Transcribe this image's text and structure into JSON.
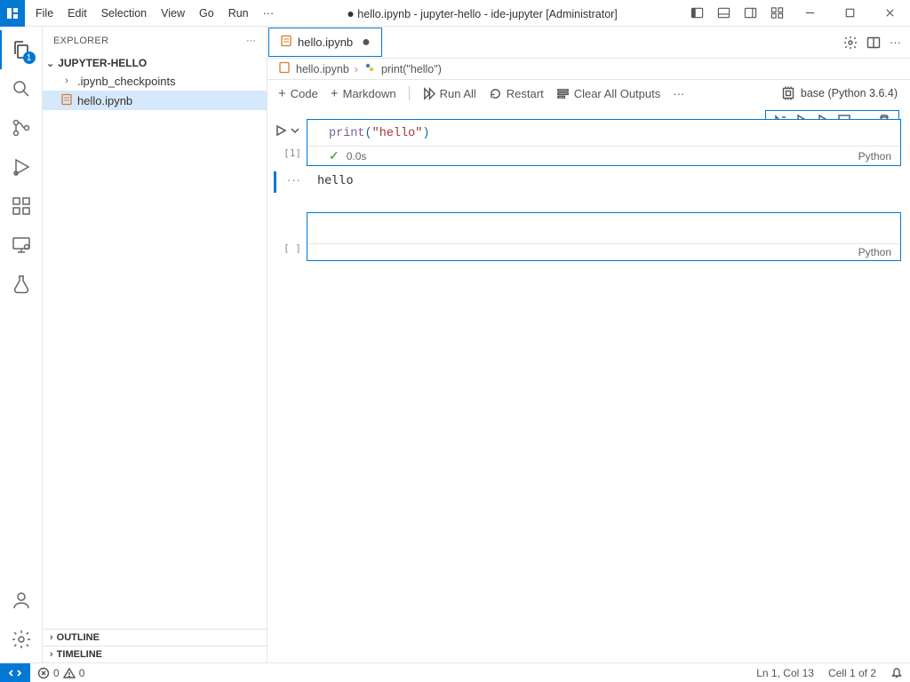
{
  "window": {
    "title": "hello.ipynb - jupyter-hello - ide-jupyter [Administrator]",
    "dirty_prefix": "●"
  },
  "menu": {
    "items": [
      "File",
      "Edit",
      "Selection",
      "View",
      "Go",
      "Run"
    ],
    "overflow": "···"
  },
  "activitybar": {
    "explorer_badge": "1"
  },
  "sidebar": {
    "title": "EXPLORER",
    "root": "JUPYTER-HELLO",
    "items": [
      {
        "label": ".ipynb_checkpoints",
        "kind": "folder"
      },
      {
        "label": "hello.ipynb",
        "kind": "notebook",
        "selected": true
      }
    ],
    "outline": "OUTLINE",
    "timeline": "TIMELINE"
  },
  "tab": {
    "label": "hello.ipynb",
    "dirty": "●"
  },
  "breadcrumbs": {
    "file": "hello.ipynb",
    "symbol": "print(\"hello\")"
  },
  "nb_toolbar": {
    "code": "Code",
    "markdown": "Markdown",
    "run_all": "Run All",
    "restart": "Restart",
    "clear": "Clear All Outputs",
    "kernel": "base (Python 3.6.4)"
  },
  "cells": [
    {
      "exec_count": "[1]",
      "code": {
        "fn": "print",
        "str": "\"hello\""
      },
      "status_time": "0.0s",
      "lang": "Python",
      "output": "hello"
    },
    {
      "exec_count": "[ ]",
      "lang": "Python"
    }
  ],
  "statusbar": {
    "errors": "0",
    "warnings": "0",
    "position": "Ln 1, Col 13",
    "cellinfo": "Cell 1 of 2"
  }
}
